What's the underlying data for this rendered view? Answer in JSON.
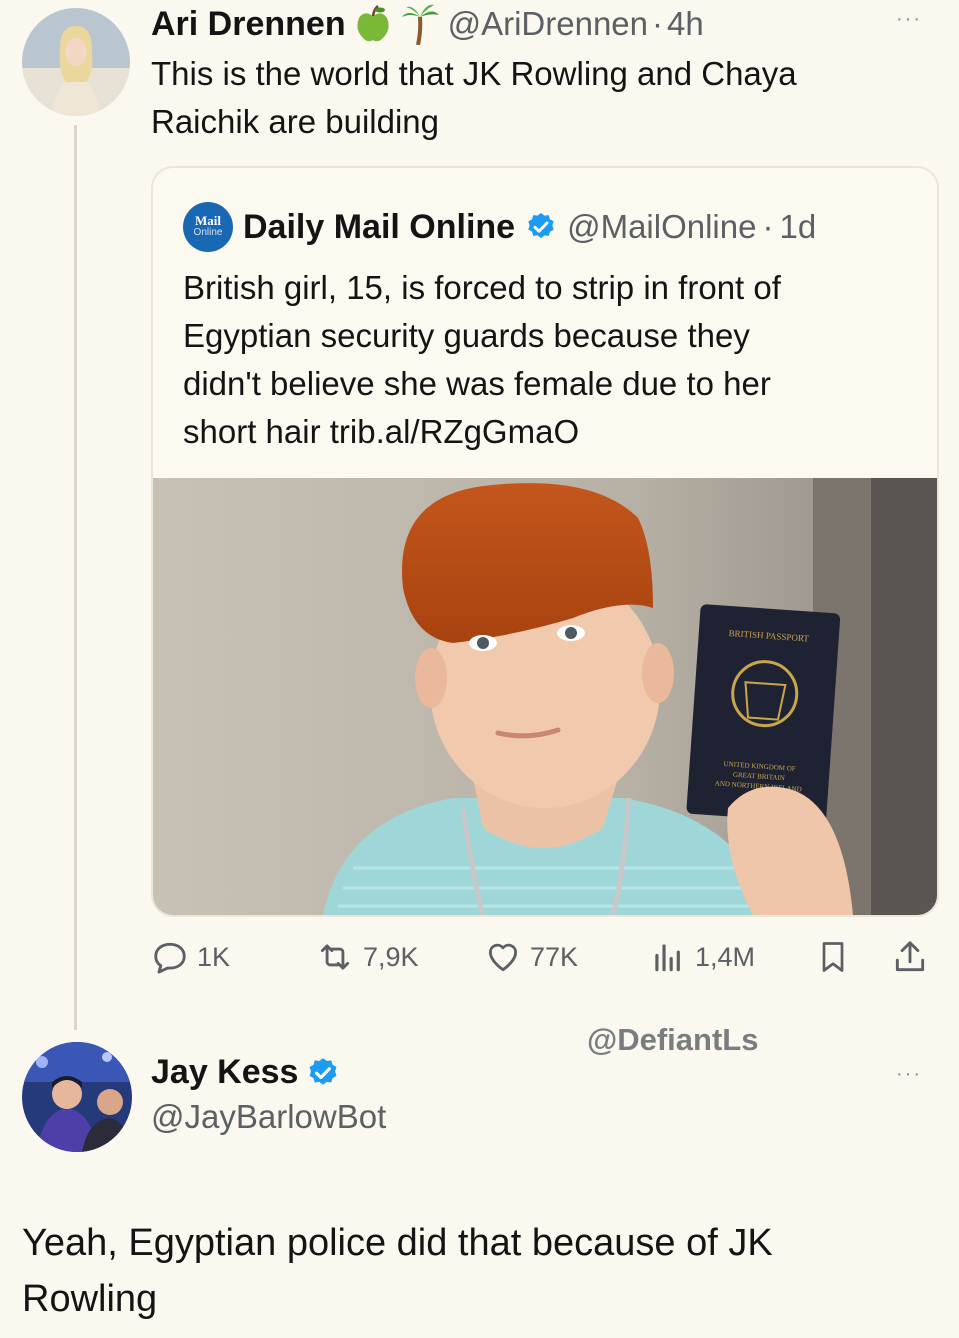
{
  "tweet1": {
    "display_name": "Ari Drennen",
    "emojis": [
      "green-apple-icon",
      "palm-tree-icon"
    ],
    "handle": "@AriDrennen",
    "separator": "·",
    "time": "4h",
    "text_line1": "This is the world that JK Rowling and Chaya",
    "text_line2": "Raichik are building",
    "more": "···"
  },
  "quoted": {
    "logo_text_top": "Mail",
    "logo_text_bottom": "Online",
    "display_name": "Daily Mail Online",
    "handle": "@MailOnline",
    "separator": "·",
    "time": "1d",
    "text_lines": [
      "British girl, 15, is forced to strip in front of",
      "Egyptian security guards because they",
      "didn't believe she was female due to her",
      "short hair trib.al/RZgGmaO"
    ],
    "passport_title": "BRITISH PASSPORT",
    "passport_lines": [
      "UNITED KINGDOM OF",
      "GREAT BRITAIN",
      "AND NORTHERN IRELAND"
    ]
  },
  "actions": {
    "replies": "1K",
    "reposts": "7,9K",
    "likes": "77K",
    "views": "1,4M"
  },
  "watermark": "@DefiantLs",
  "tweet2": {
    "display_name": "Jay Kess",
    "handle": "@JayBarlowBot",
    "more": "···",
    "text_line1": "Yeah, Egyptian police did that because of JK",
    "text_line2": "Rowling"
  },
  "colors": {
    "verified": "#1d9bf0",
    "background": "#fbf8ef"
  }
}
